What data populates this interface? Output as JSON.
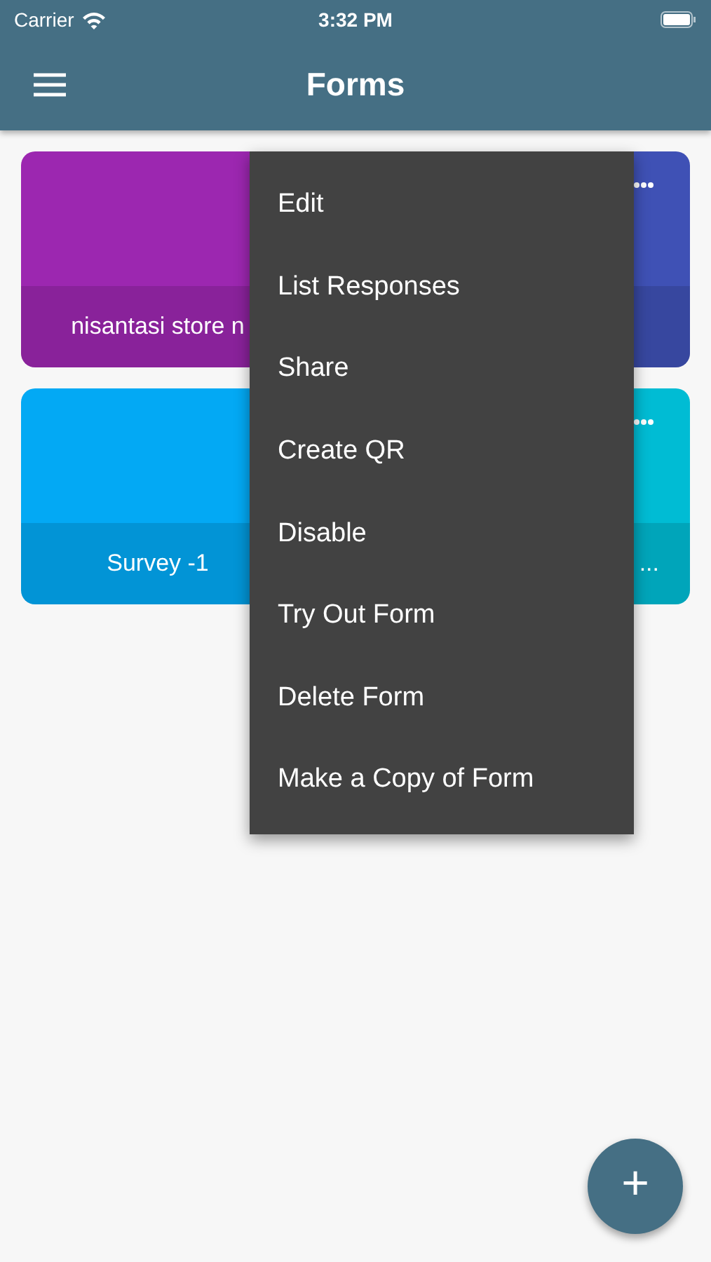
{
  "status_bar": {
    "carrier": "Carrier",
    "time": "3:32 PM"
  },
  "app_bar": {
    "title": "Forms"
  },
  "cards": [
    {
      "title": "nisantasi store n",
      "color": "#9c27b0",
      "more": false
    },
    {
      "color": "#3f51b5",
      "more": true
    },
    {
      "title": "Survey -1",
      "color": "#03a9f4",
      "more": false
    },
    {
      "title": "...",
      "color": "#00bcd4",
      "more": true
    }
  ],
  "menu": {
    "items": [
      "Edit",
      "List Responses",
      "Share",
      "Create QR",
      "Disable",
      "Try Out Form",
      "Delete Form",
      "Make a Copy of Form"
    ]
  },
  "fab": {
    "label": "+"
  }
}
